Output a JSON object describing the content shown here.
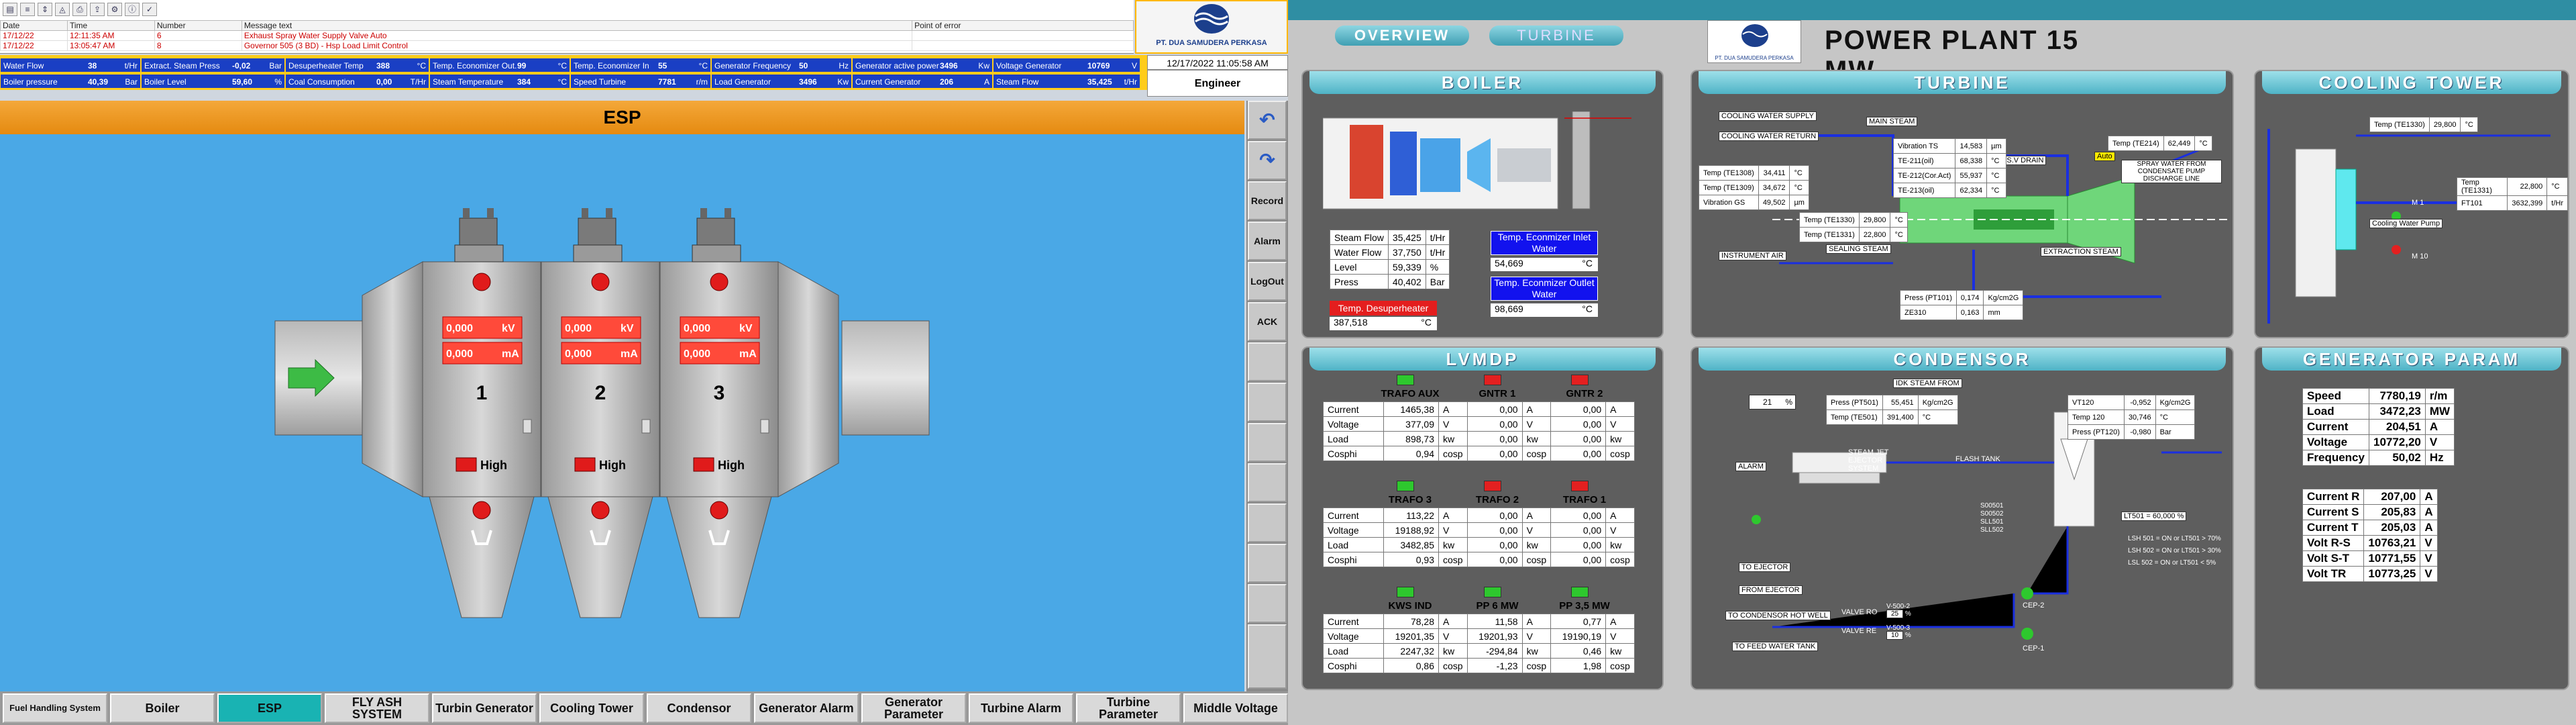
{
  "alarm": {
    "headers": [
      "Date",
      "Time",
      "Number",
      "Message text",
      "Point of error"
    ],
    "rows": [
      [
        "17/12/22",
        "12:11:35 AM",
        "6",
        "Exhaust Spray Water Supply Valve Auto",
        ""
      ],
      [
        "17/12/22",
        "13:05:47 AM",
        "8",
        "Governor 505 (3 BD) - Hsp Load Limit Control",
        ""
      ]
    ],
    "icons": [
      "document-icon",
      "list-icon",
      "up-down-icon",
      "filter-icon",
      "print-icon",
      "export-icon",
      "settings-icon",
      "info-icon",
      "check-icon"
    ]
  },
  "company": "PT. DUA SAMUDERA PERKASA",
  "datetime": "12/17/2022 11:05:58 AM",
  "role": "Engineer",
  "status": [
    {
      "label": "Water Flow",
      "value": "38",
      "unit": "t/Hr"
    },
    {
      "label": "Extract. Steam Press",
      "value": "-0,02",
      "unit": "Bar"
    },
    {
      "label": "Desuperheater Temp",
      "value": "388",
      "unit": "°C"
    },
    {
      "label": "Temp. Economizer Out.",
      "value": "99",
      "unit": "°C"
    },
    {
      "label": "Temp. Economizer In",
      "value": "55",
      "unit": "°C"
    },
    {
      "label": "Generator Frequency",
      "value": "50",
      "unit": "Hz"
    },
    {
      "label": "Generator active power",
      "value": "3496",
      "unit": "Kw"
    },
    {
      "label": "Voltage Generator",
      "value": "10769",
      "unit": "V"
    },
    {
      "label": "Boiler pressure",
      "value": "40,39",
      "unit": "Bar"
    },
    {
      "label": "Boiler Level",
      "value": "59,60",
      "unit": "%"
    },
    {
      "label": "Coal Consumption",
      "value": "0,00",
      "unit": "T/Hr"
    },
    {
      "label": "Steam Temperature",
      "value": "384",
      "unit": "°C"
    },
    {
      "label": "Speed Turbine",
      "value": "7781",
      "unit": "r/m"
    },
    {
      "label": "Load Generator",
      "value": "3496",
      "unit": "Kw"
    },
    {
      "label": "Current Generator",
      "value": "206",
      "unit": "A"
    },
    {
      "label": "Steam Flow",
      "value": "35,425",
      "unit": "t/Hr"
    }
  ],
  "esp": {
    "title": "ESP",
    "units": [
      {
        "num": "1",
        "kv": "0,000",
        "ma": "0,000",
        "high": "High"
      },
      {
        "num": "2",
        "kv": "0,000",
        "ma": "0,000",
        "high": "High"
      },
      {
        "num": "3",
        "kv": "0,000",
        "ma": "0,000",
        "high": "High"
      }
    ],
    "kv_unit": "kV",
    "ma_unit": "mA"
  },
  "side": {
    "record": "Record",
    "alarm": "Alarm",
    "logout": "LogOut",
    "ack": "ACK"
  },
  "nav_left": [
    "Fuel Handling System",
    "Boiler",
    "ESP",
    "FLY ASH SYSTEM",
    "Turbin Generator",
    "Cooling Tower",
    "Condensor",
    "Generator Alarm",
    "Generator Parameter",
    "Turbine Alarm",
    "Turbine Parameter",
    "Middle Voltage"
  ],
  "right": {
    "tabs": [
      "OVERVIEW",
      "TURBINE"
    ],
    "title": "POWER PLANT 15 MW",
    "company_small": "PT. DUA SAMUDERA PERKASA",
    "boiler": {
      "title": "BOILER",
      "rows": [
        [
          "Steam Flow",
          "35,425",
          "t/Hr"
        ],
        [
          "Water Flow",
          "37,750",
          "t/Hr"
        ],
        [
          "Level",
          "59,339",
          "%"
        ],
        [
          "Press",
          "40,402",
          "Bar"
        ]
      ],
      "econ_in_label": "Temp. Econmizer Inlet Water",
      "econ_in": "54,669",
      "econ_out_label": "Temp. Econmizer Outlet Water",
      "econ_out": "98,669",
      "desup_label": "Temp. Desuperheater",
      "desup": "387,518",
      "deg": "°C"
    },
    "turbine": {
      "title": "TURBINE",
      "tags": [
        "COOLING WATER SUPPLY",
        "COOLING WATER RETURN",
        "MAIN STEAM",
        "E.S.V DRAIN",
        "SEALING STEAM",
        "INSTRUMENT AIR",
        "EXTRACTION STEAM",
        "SPRAY WATER FROM CONDENSATE PUMP DISCHARGE LINE",
        "Auto"
      ],
      "vib": [
        [
          "Vibration TS",
          "14,583",
          "µm"
        ],
        [
          "TE-211(oil)",
          "68,338",
          "°C"
        ],
        [
          "TE-212(Cor.Act)",
          "55,937",
          "°C"
        ],
        [
          "TE-213(oil)",
          "62,334",
          "°C"
        ]
      ],
      "temps": [
        [
          "Temp (TE1308)",
          "34,411",
          "°C"
        ],
        [
          "Temp (TE1309)",
          "34,672",
          "°C"
        ],
        [
          "Vibration GS",
          "49,502",
          "µm"
        ]
      ],
      "te1330": [
        "Temp (TE1330)",
        "29,800",
        "°C"
      ],
      "te1331": [
        "Temp (TE1331)",
        "22,800",
        "°C"
      ],
      "te214": [
        "Temp (TE214)",
        "62,449",
        "°C"
      ],
      "pt1101": [
        "Press (PT101)",
        "0,174",
        "Kg/cm2G"
      ],
      "ze310": [
        "ZE310",
        "0,163",
        "mm"
      ]
    },
    "cooling": {
      "title": "COOLING TOWER",
      "te1330": [
        "Temp (TE1330)",
        "29,800",
        "°C"
      ],
      "te1331": [
        "Temp (TE1331)",
        "22,800",
        "°C"
      ],
      "ft101": [
        "FT101",
        "3632,399",
        "t/Hr"
      ],
      "pump": "Cooling Water Pump",
      "m1": "M 1",
      "m2": "M 10"
    },
    "lvmdp": {
      "title": "LVMDP",
      "groups": [
        {
          "names": [
            "TRAFO AUX",
            "GNTR 1",
            "GNTR 2"
          ],
          "status": [
            "green",
            "red",
            "red"
          ],
          "rows": [
            [
              "Current",
              "1465,38",
              "A",
              "0,00",
              "A",
              "0,00",
              "A"
            ],
            [
              "Voltage",
              "377,09",
              "V",
              "0,00",
              "V",
              "0,00",
              "V"
            ],
            [
              "Load",
              "898,73",
              "kw",
              "0,00",
              "kw",
              "0,00",
              "kw"
            ],
            [
              "Cosphi",
              "0,94",
              "cosp",
              "0,00",
              "cosp",
              "0,00",
              "cosp"
            ]
          ]
        },
        {
          "names": [
            "TRAFO 3",
            "TRAFO 2",
            "TRAFO 1"
          ],
          "status": [
            "green",
            "red",
            "red"
          ],
          "rows": [
            [
              "Current",
              "113,22",
              "A",
              "0,00",
              "A",
              "0,00",
              "A"
            ],
            [
              "Voltage",
              "19188,92",
              "V",
              "0,00",
              "V",
              "0,00",
              "V"
            ],
            [
              "Load",
              "3482,85",
              "kw",
              "0,00",
              "kw",
              "0,00",
              "kw"
            ],
            [
              "Cosphi",
              "0,93",
              "cosp",
              "0,00",
              "cosp",
              "0,00",
              "cosp"
            ]
          ]
        },
        {
          "names": [
            "KWS IND",
            "PP 6 MW",
            "PP 3,5 MW"
          ],
          "status": [
            "green",
            "green",
            "green"
          ],
          "rows": [
            [
              "Current",
              "78,28",
              "A",
              "11,58",
              "A",
              "0,77",
              "A"
            ],
            [
              "Voltage",
              "19201,35",
              "V",
              "19201,93",
              "V",
              "19190,19",
              "V"
            ],
            [
              "Load",
              "2247,32",
              "kw",
              "-294,84",
              "kw",
              "0,46",
              "kw"
            ],
            [
              "Cosphi",
              "0,86",
              "cosp",
              "-1,23",
              "cosp",
              "1,98",
              "cosp"
            ]
          ]
        }
      ]
    },
    "condensor": {
      "title": "CONDENSOR",
      "level": "21",
      "level_unit": "%",
      "tags": [
        "IDK STEAM FROM",
        "STEAM JET EJECTOR SYSTEM",
        "FLASH TANK",
        "TO EJECTOR",
        "FROM EJECTOR",
        "TO CONDENSOR HOT WELL",
        "TO FEED WATER TANK",
        "VALVE RO",
        "VALVE RE",
        "CEP-1",
        "CEP-2",
        "LT501",
        "S00501",
        "S00502",
        "SLL501",
        "SLL502",
        "ALARM"
      ],
      "pt501": [
        "Press (PT501)",
        "55,451",
        "Kg/cm2G"
      ],
      "te501": [
        "Temp (TE501)",
        "391,400",
        "°C"
      ],
      "vt120": [
        "VT120",
        "-0,952",
        "Kg/cm2G"
      ],
      "t120": [
        "Temp 120",
        "30,746",
        "°C"
      ],
      "pt120": [
        "Press (PT120)",
        "-0,980",
        "Bar"
      ],
      "lt501": "LT501 = 60,000 %",
      "ls": [
        "LSH 501 = ON or LT501 > 70%",
        "LSH 502 = ON or LT501 > 30%",
        "LSL 502 = ON or LT501 < 5%"
      ],
      "v1": [
        "V-500-2",
        "25",
        "%"
      ],
      "v2": [
        "V-500-3",
        "10",
        "%"
      ]
    },
    "gen": {
      "title": "GENERATOR PARAM",
      "a": [
        [
          "Speed",
          "7780,19",
          "r/m"
        ],
        [
          "Load",
          "3472,23",
          "MW"
        ],
        [
          "Current",
          "204,51",
          "A"
        ],
        [
          "Voltage",
          "10772,20",
          "V"
        ],
        [
          "Frequency",
          "50,02",
          "Hz"
        ]
      ],
      "b": [
        [
          "Current R",
          "207,00",
          "A"
        ],
        [
          "Current S",
          "205,83",
          "A"
        ],
        [
          "Current T",
          "205,03",
          "A"
        ],
        [
          "Volt R-S",
          "10763,21",
          "V"
        ],
        [
          "Volt S-T",
          "10771,55",
          "V"
        ],
        [
          "Volt TR",
          "10773,25",
          "V"
        ]
      ]
    }
  }
}
